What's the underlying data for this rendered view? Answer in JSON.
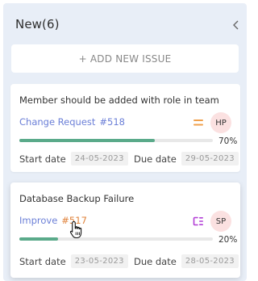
{
  "column": {
    "title": "New(6)",
    "add_button_label": "+ ADD NEW ISSUE"
  },
  "cards": [
    {
      "title": "Member should be added with role in team",
      "issue_type": "Change Request",
      "issue_id": "#518",
      "priority_icon": "medium-priority-icon",
      "priority_color": "#f0a04b",
      "assignee": "HP",
      "progress": 70,
      "progress_label": "70%",
      "start_label": "Start date",
      "start_date": "24-05-2023",
      "due_label": "Due date",
      "due_date": "29-05-2023"
    },
    {
      "title": "Database Backup Failure",
      "issue_type": "Improve",
      "issue_id": "#517",
      "priority_icon": "low-priority-icon",
      "priority_color": "#b23fd6",
      "assignee": "SP",
      "progress": 20,
      "progress_label": "20%",
      "start_label": "Start date",
      "start_date": "23-05-2023",
      "due_label": "Due date",
      "due_date": "28-05-2023"
    }
  ],
  "colors": {
    "column_bg": "#e8eef7",
    "progress_fill": "#5aaa8a",
    "issue_type_link": "#6b7fd7",
    "improve_id": "#e0823a",
    "avatar_bg": "#fbe1e1"
  }
}
